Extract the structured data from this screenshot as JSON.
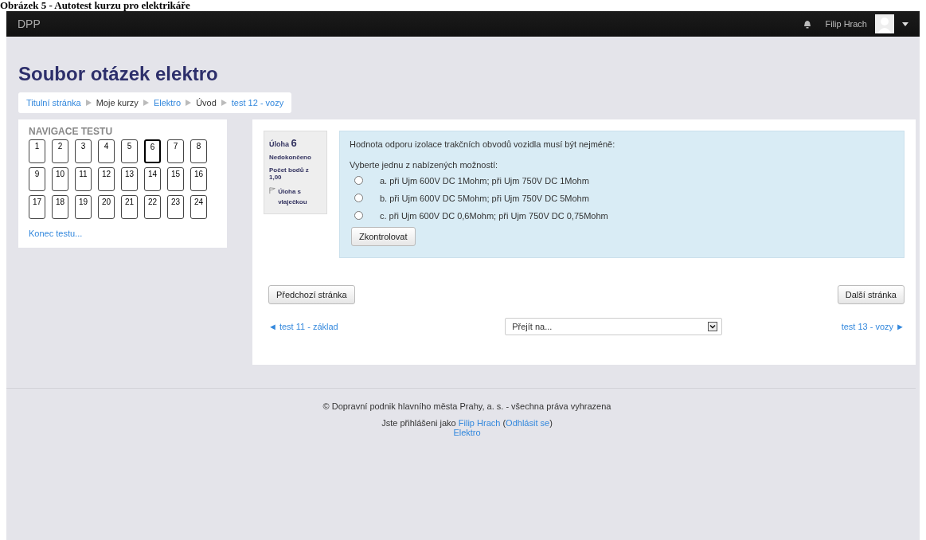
{
  "caption": "Obrázek 5 - Autotest kurzu pro elektrikáře",
  "navbar": {
    "brand": "DPP",
    "user_name": "Filip Hrach"
  },
  "page_title": "Soubor otázek elektro",
  "breadcrumb": [
    {
      "label": "Titulní stránka",
      "kind": "link"
    },
    {
      "label": "Moje kurzy",
      "kind": "text"
    },
    {
      "label": "Elektro",
      "kind": "link"
    },
    {
      "label": "Úvod",
      "kind": "text"
    },
    {
      "label": "test 12 - vozy",
      "kind": "link"
    }
  ],
  "quiz_nav": {
    "title": "NAVIGACE TESTU",
    "items": [
      {
        "label": "1",
        "selected": false
      },
      {
        "label": "2",
        "selected": false
      },
      {
        "label": "3",
        "selected": false
      },
      {
        "label": "4",
        "selected": false
      },
      {
        "label": "5",
        "selected": false
      },
      {
        "label": "6",
        "selected": true
      },
      {
        "label": "7",
        "selected": false
      },
      {
        "label": "8",
        "selected": false
      },
      {
        "label": "9",
        "selected": false
      },
      {
        "label": "10",
        "selected": false
      },
      {
        "label": "11",
        "selected": false
      },
      {
        "label": "12",
        "selected": false
      },
      {
        "label": "13",
        "selected": false
      },
      {
        "label": "14",
        "selected": false
      },
      {
        "label": "15",
        "selected": false
      },
      {
        "label": "16",
        "selected": false
      },
      {
        "label": "17",
        "selected": false
      },
      {
        "label": "18",
        "selected": false
      },
      {
        "label": "19",
        "selected": false
      },
      {
        "label": "20",
        "selected": false
      },
      {
        "label": "21",
        "selected": false
      },
      {
        "label": "22",
        "selected": false
      },
      {
        "label": "23",
        "selected": false
      },
      {
        "label": "24",
        "selected": false
      }
    ],
    "finish_link": "Konec testu..."
  },
  "question": {
    "heading": "Úloha",
    "number": "6",
    "status": "Nedokončeno",
    "points": "Počet bodů z 1,00",
    "flag_label": "Úloha s vlaječkou",
    "text": "Hodnota odporu izolace trakčních obvodů vozidla musí být nejméně:",
    "prompt": "Vyberte jednu z nabízených možností:",
    "options": [
      {
        "label": "a. při Ujm 600V DC 1Mohm; při Ujm 750V DC 1Mohm",
        "selected": false
      },
      {
        "label": "b. při Ujm 600V DC 5Mohm; při Ujm 750V DC 5Mohm",
        "selected": false
      },
      {
        "label": "c. při Ujm 600V DC 0,6Mohm; při Ujm 750V DC 0,75Mohm",
        "selected": false
      }
    ],
    "check_button": "Zkontrolovat"
  },
  "prev_button": "Předchozí stránka",
  "next_button": "Další stránka",
  "prev_activity": "◄ test 11 - základ",
  "jump": {
    "value": "Přejít na..."
  },
  "next_activity": "test 13 - vozy ►",
  "footer": {
    "copyright": "© Dopravní podnik hlavního města Prahy, a. s. - všechna práva vyhrazena",
    "login_prefix": "Jste přihlášeni jako",
    "user_link": "Filip Hrach",
    "open": "(",
    "logout_link": "Odhlásit se",
    "close": ")",
    "course_link": "Elektro"
  }
}
